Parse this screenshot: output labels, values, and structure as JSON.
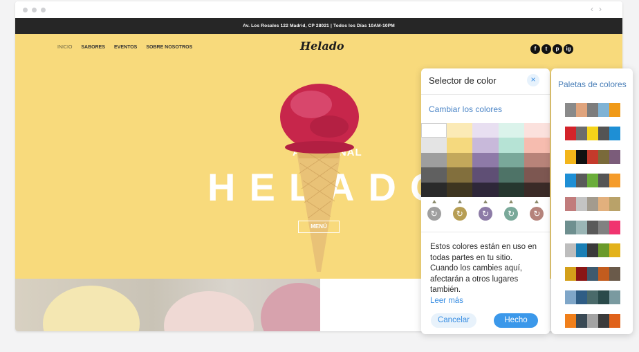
{
  "site": {
    "topbar_text": "Av. Los Rosales 122 Madrid, CP 28021  |  Todos los Días 10AM-10PM",
    "menu": [
      "INICIO",
      "SABORES",
      "EVENTOS",
      "SOBRE NOSOTROS"
    ],
    "logo": "Helado",
    "social": [
      "f",
      "t",
      "p",
      "ig"
    ],
    "tagline": "ARTESENAL",
    "headline": "HELADO",
    "menu_button": "MENÚ"
  },
  "picker": {
    "title": "Selector de color",
    "close": "×",
    "change_colors": "Cambiar los colores",
    "columns": [
      {
        "shades": [
          "#ffffff",
          "#e4e4e4",
          "#9e9e9e",
          "#606060",
          "#2a2a2a"
        ],
        "accent": "#9f9f9f"
      },
      {
        "shades": [
          "#fbeab6",
          "#f5d97e",
          "#c3a85b",
          "#826f3d",
          "#3e3520"
        ],
        "accent": "#b79e54"
      },
      {
        "shades": [
          "#e8dff1",
          "#c8b9da",
          "#8e7aa8",
          "#5f4f75",
          "#2e2739"
        ],
        "accent": "#8c7ba6"
      },
      {
        "shades": [
          "#dbf3eb",
          "#b6e3d5",
          "#79a89a",
          "#4e7367",
          "#26372f"
        ],
        "accent": "#7aa99a"
      },
      {
        "shades": [
          "#fbe1dd",
          "#f6bcaf",
          "#b88379",
          "#7d5751",
          "#3a2a27"
        ],
        "accent": "#b5837b"
      }
    ],
    "refresh_icon": "↻",
    "info_text": "Estos colores están en uso en todas partes en tu sitio. Cuando los cambies aquí, afectarán a otros lugares también.",
    "read_more": "Leer más",
    "cancel": "Cancelar",
    "done": "Hecho"
  },
  "palettes": {
    "title": "Paletas de colores",
    "rows": [
      [
        "#8a8a8a",
        "#e0a47d",
        "#7d7d7d",
        "#7fb3d5",
        "#f09a18"
      ],
      [
        "#d3232a",
        "#6c6c6c",
        "#f5d41a",
        "#545454",
        "#1e8fd5"
      ],
      [
        "#f3b51a",
        "#111111",
        "#c43a2b",
        "#7a6a3a",
        "#7b5c7a"
      ],
      [
        "#1e8fd5",
        "#5a5a5a",
        "#6aad3a",
        "#555555",
        "#f59b2a"
      ],
      [
        "#c17c7c",
        "#c4c4c4",
        "#a39b8e",
        "#e2b07d",
        "#b9a269"
      ],
      [
        "#6e8f8f",
        "#9ab5b5",
        "#5a5a5a",
        "#818181",
        "#f0346f"
      ],
      [
        "#bdbdbd",
        "#1a7fb5",
        "#3a3a3a",
        "#6a9a2a",
        "#e3b21a"
      ],
      [
        "#d4a01a",
        "#8a1616",
        "#3e5a6e",
        "#c25c1e",
        "#6a5a4a"
      ],
      [
        "#7fa6c8",
        "#2f5d85",
        "#4a6a6a",
        "#2a4a4a",
        "#7a9aa0"
      ],
      [
        "#f07f1a",
        "#3a4a55",
        "#a3a3a3",
        "#3b3b3b",
        "#e0621a"
      ]
    ]
  }
}
